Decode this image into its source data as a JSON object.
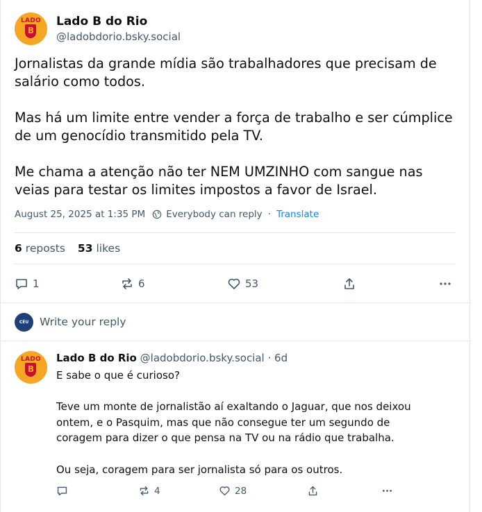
{
  "post": {
    "display_name": "Lado B do Rio",
    "handle": "@ladobdorio.bsky.social",
    "avatar_text": "LADO",
    "avatar_letter": "B",
    "text": "Jornalistas da grande mídia são trabalhadores que precisam de salário como todos.\n\nMas há um limite entre vender a força de trabalho e ser cúmplice de um genocídio transmitido pela TV.\n\nMe chama a atenção não ter NEM UMZINHO com sangue nas veias para testar os limites impostos a favor de Israel.",
    "timestamp": "August 25, 2025 at 1:35 PM",
    "reply_setting": "Everybody can reply",
    "separator": "·",
    "translate": "Translate",
    "reposts_count": "6",
    "reposts_label": "reposts",
    "likes_count": "53",
    "likes_label": "likes",
    "actions": {
      "reply_count": "1",
      "repost_count": "6",
      "like_count": "53"
    }
  },
  "composer": {
    "placeholder": "Write your reply",
    "avatar_text": "CÉU"
  },
  "reply": {
    "display_name": "Lado B do Rio",
    "handle": "@ladobdorio.bsky.social",
    "age": "· 6d",
    "text": "E sabe o que é curioso?\n\nTeve um monte de jornalistão aí exaltando o Jaguar, que nos deixou ontem, e o Pasquim, mas que não consegue ter um segundo de coragem para dizer o que pensa na TV ou na rádio que trabalha.\n\nOu seja, coragem para ser jornalista só para os outros.",
    "actions": {
      "reply_count": "",
      "repost_count": "4",
      "like_count": "28"
    }
  },
  "colors": {
    "accent": "#1083fe",
    "muted": "#42576c",
    "divider": "#e3e6ea",
    "avatar_bg": "#f5a623",
    "avatar_red": "#c8102e"
  },
  "icons": [
    "reply-icon",
    "repost-icon",
    "like-icon",
    "share-icon",
    "more-icon",
    "globe-icon"
  ]
}
